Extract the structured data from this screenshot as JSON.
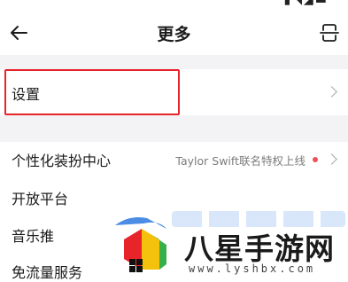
{
  "header": {
    "title": "更多",
    "back_icon": "back-arrow-icon",
    "scan_icon": "scan-icon"
  },
  "settings_row": {
    "label": "设置",
    "highlight_color": "#e8242b"
  },
  "menu": {
    "items": [
      {
        "label": "个性化装扮中心",
        "trailing_text": "Taylor Swift联名特权上线",
        "badge_color": "#f0505a"
      },
      {
        "label": "开放平台"
      },
      {
        "label": "音乐推"
      },
      {
        "label": "免流量服务"
      }
    ]
  },
  "watermark": {
    "title": "八星手游网",
    "url": "www.lyshbx.com"
  }
}
